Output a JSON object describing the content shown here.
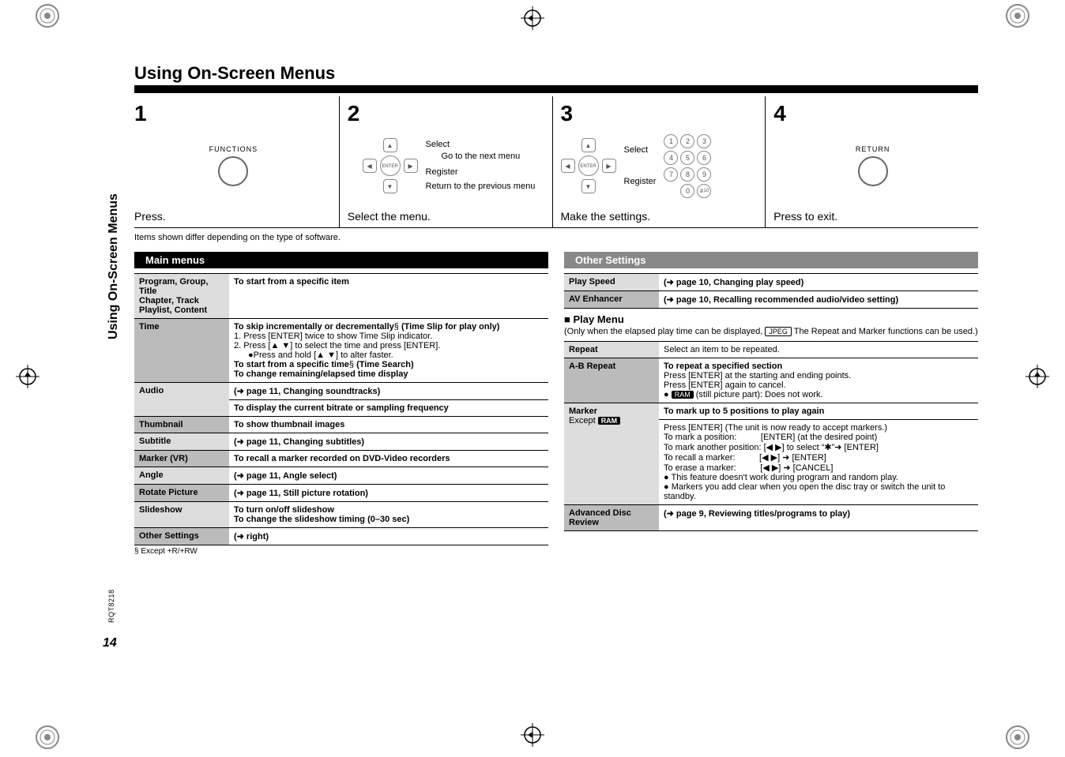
{
  "title": "Using On-Screen Menus",
  "steps": {
    "s1": {
      "num": "1",
      "button_label": "FUNCTIONS",
      "caption": "Press."
    },
    "s2": {
      "num": "2",
      "select": "Select",
      "goto": "Go to the next menu",
      "register": "Register",
      "return": "Return to the previous menu",
      "caption": "Select the menu."
    },
    "s3": {
      "num": "3",
      "select": "Select",
      "register": "Register",
      "caption": "Make the settings."
    },
    "s4": {
      "num": "4",
      "button_label": "RETURN",
      "caption": "Press to exit."
    }
  },
  "items_note": "Items shown differ depending on the type of software.",
  "main_menus_header": "Main menus",
  "other_settings_header": "Other Settings",
  "main_rows": {
    "prog_label": "Program, Group, Title\nChapter, Track\nPlaylist, Content",
    "prog_desc": "To start from a specific item",
    "time_label": "Time",
    "time_l1": "To skip incrementally or decrementally",
    "time_l1_suffix": " (Time Slip for play only)",
    "time_l2": "1.   Press [ENTER] twice to show Time Slip indicator.",
    "time_l3": "2.   Press [▲ ▼] to select the time and press [ENTER].",
    "time_l4": "●Press and hold [▲ ▼] to alter faster.",
    "time_l5": "To start from a specific time",
    "time_l5_suffix": " (Time Search)",
    "time_l6": "To change remaining/elapsed time display",
    "audio_label": "Audio",
    "audio_l1": "(➜ page 11, Changing soundtracks)",
    "audio_l2": "To display the current bitrate or sampling frequency",
    "thumb_label": "Thumbnail",
    "thumb_desc": "To show thumbnail images",
    "sub_label": "Subtitle",
    "sub_desc": "(➜ page 11, Changing subtitles)",
    "marker_label": "Marker (VR)",
    "marker_desc": "To recall a marker recorded on DVD-Video recorders",
    "angle_label": "Angle",
    "angle_desc": "(➜ page 11, Angle select)",
    "rotate_label": "Rotate Picture",
    "rotate_desc": "(➜ page 11, Still picture rotation)",
    "slide_label": "Slideshow",
    "slide_l1": "To turn on/off slideshow",
    "slide_l2": "To change the slideshow timing (0–30 sec)",
    "other_label": "Other Settings",
    "other_desc": "(➜ right)"
  },
  "other_rows": {
    "ps_label": "Play Speed",
    "ps_desc": "(➜ page 10, Changing play speed)",
    "av_label": "AV Enhancer",
    "av_desc": "(➜ page 10, Recalling recommended audio/video setting)"
  },
  "play_menu": {
    "header": "■ Play Menu",
    "note_prefix": "(Only when the elapsed play time can be displayed, ",
    "note_chip": "JPEG",
    "note_suffix": " The Repeat and Marker functions can be used.)",
    "repeat_label": "Repeat",
    "repeat_desc": "Select an item to be repeated.",
    "ab_label": "A-B Repeat",
    "ab_l1": "To repeat a specified section",
    "ab_l2": "Press [ENTER] at the starting and ending points.",
    "ab_l3": "Press [ENTER] again to cancel.",
    "ab_l4_prefix": "● ",
    "ab_l4_chip": "RAM",
    "ab_l4_suffix": " (still picture part): Does not work.",
    "mk_label": "Marker",
    "mk_except": "Except ",
    "mk_except_chip": "RAM",
    "mk_l0": "To mark up to 5 positions to play again",
    "mk_l1": "Press [ENTER] (The unit is now ready to accept markers.)",
    "mk_l2a": "To mark a position:",
    "mk_l2b": "[ENTER] (at the desired point)",
    "mk_l3a": "To mark another position:",
    "mk_l3b": "[◀ ▶] to select “✱”➜ [ENTER]",
    "mk_l4a": "To recall a marker:",
    "mk_l4b": "[◀ ▶] ➜ [ENTER]",
    "mk_l5a": "To erase a marker:",
    "mk_l5b": "[◀ ▶] ➜ [CANCEL]",
    "mk_l6": "● This feature doesn't work during program and random play.",
    "mk_l7": "● Markers you add clear when you open the disc tray or switch the unit to standby.",
    "adv_label": "Advanced Disc Review",
    "adv_desc": "(➜ page 9, Reviewing titles/programs to play)"
  },
  "footnote_left": "§ Except +R/+RW",
  "side_label": "Using On-Screen Menus",
  "rqt": "RQT8218",
  "page_num": "14",
  "keypad": [
    "1",
    "2",
    "3",
    "4",
    "5",
    "6",
    "7",
    "8",
    "9",
    "0",
    "≧10"
  ],
  "enter_label": "ENTER"
}
